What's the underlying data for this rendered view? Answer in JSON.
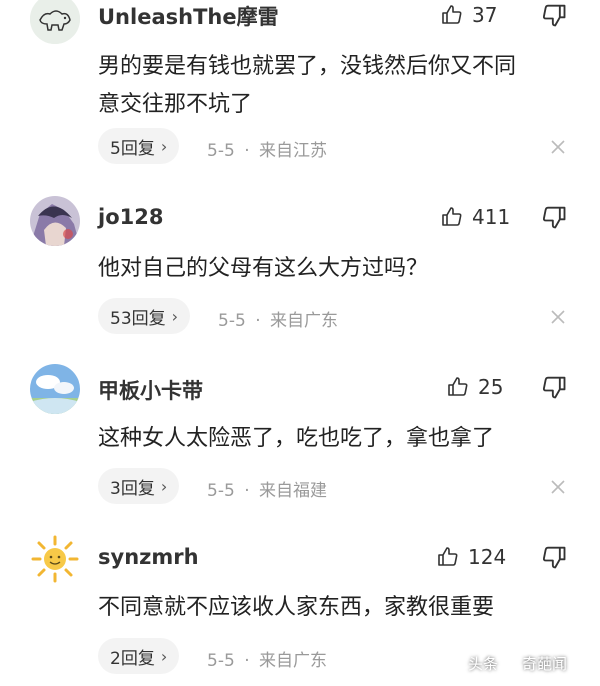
{
  "comments": [
    {
      "username": "UnleashThe摩雷",
      "likes": "37",
      "text_lines": [
        "男的要是有钱也就罢了，没钱然后你又不同",
        "意交往那不坑了"
      ],
      "reply_label": "5回复",
      "date": "5-5",
      "separator": "·",
      "location": "来自江苏",
      "avatar_icon": "dog-sketch-avatar"
    },
    {
      "username": "jo128",
      "likes": "411",
      "text_lines": [
        "他对自己的父母有这么大方过吗？"
      ],
      "reply_label": "53回复",
      "date": "5-5",
      "separator": "·",
      "location": "来自广东",
      "avatar_icon": "anime-character-avatar"
    },
    {
      "username": "甲板小卡带",
      "likes": "25",
      "text_lines": [
        "这种女人太险恶了，吃也吃了，拿也拿了"
      ],
      "reply_label": "3回复",
      "date": "5-5",
      "separator": "·",
      "location": "来自福建",
      "avatar_icon": "sky-landscape-avatar"
    },
    {
      "username": "synzmrh",
      "likes": "124",
      "text_lines": [
        "不同意就不应该收人家东西，家教很重要"
      ],
      "reply_label": "2回复",
      "date": "5-5",
      "separator": "·",
      "location": "来自广东",
      "avatar_icon": "sun-avatar"
    }
  ],
  "chevron_glyph": "›",
  "watermark": {
    "left": "头条",
    "right": "奇葩闻"
  },
  "colors": {
    "background": "#ffffff",
    "meta_gray": "#9a9a9a",
    "reply_bg": "#f3f3f3"
  }
}
